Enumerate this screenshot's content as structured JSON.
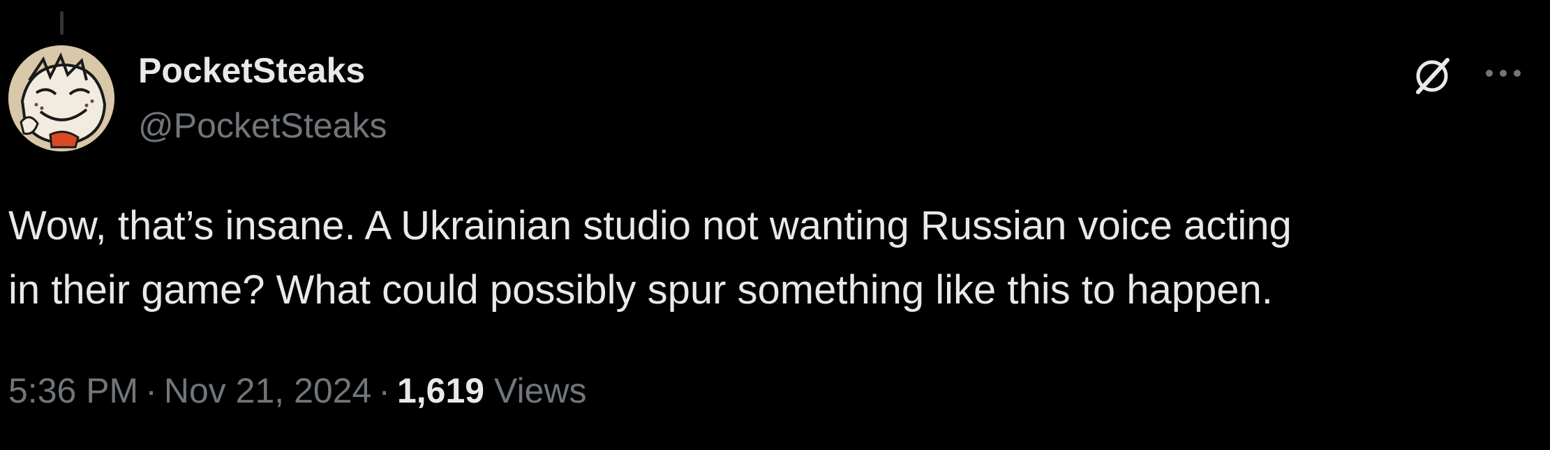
{
  "colors": {
    "background": "#000000",
    "primary_text": "#e7e9ea",
    "secondary_text": "#71767b",
    "thread_line": "#333639"
  },
  "author": {
    "display_name": "PocketSteaks",
    "handle": "@PocketSteaks",
    "avatar_icon": "cartoon-character-avatar"
  },
  "actions": {
    "grok_icon": "slashed-circle-icon",
    "more_icon": "more-horizontal-icon"
  },
  "tweet": {
    "text": "Wow, that’s insane. A Ukrainian studio not wanting Russian voice acting\nin their game? What could possibly spur something like this to happen."
  },
  "meta": {
    "time": "5:36 PM",
    "separator": "·",
    "date": "Nov 21, 2024",
    "views_count": "1,619",
    "views_label": "Views"
  }
}
